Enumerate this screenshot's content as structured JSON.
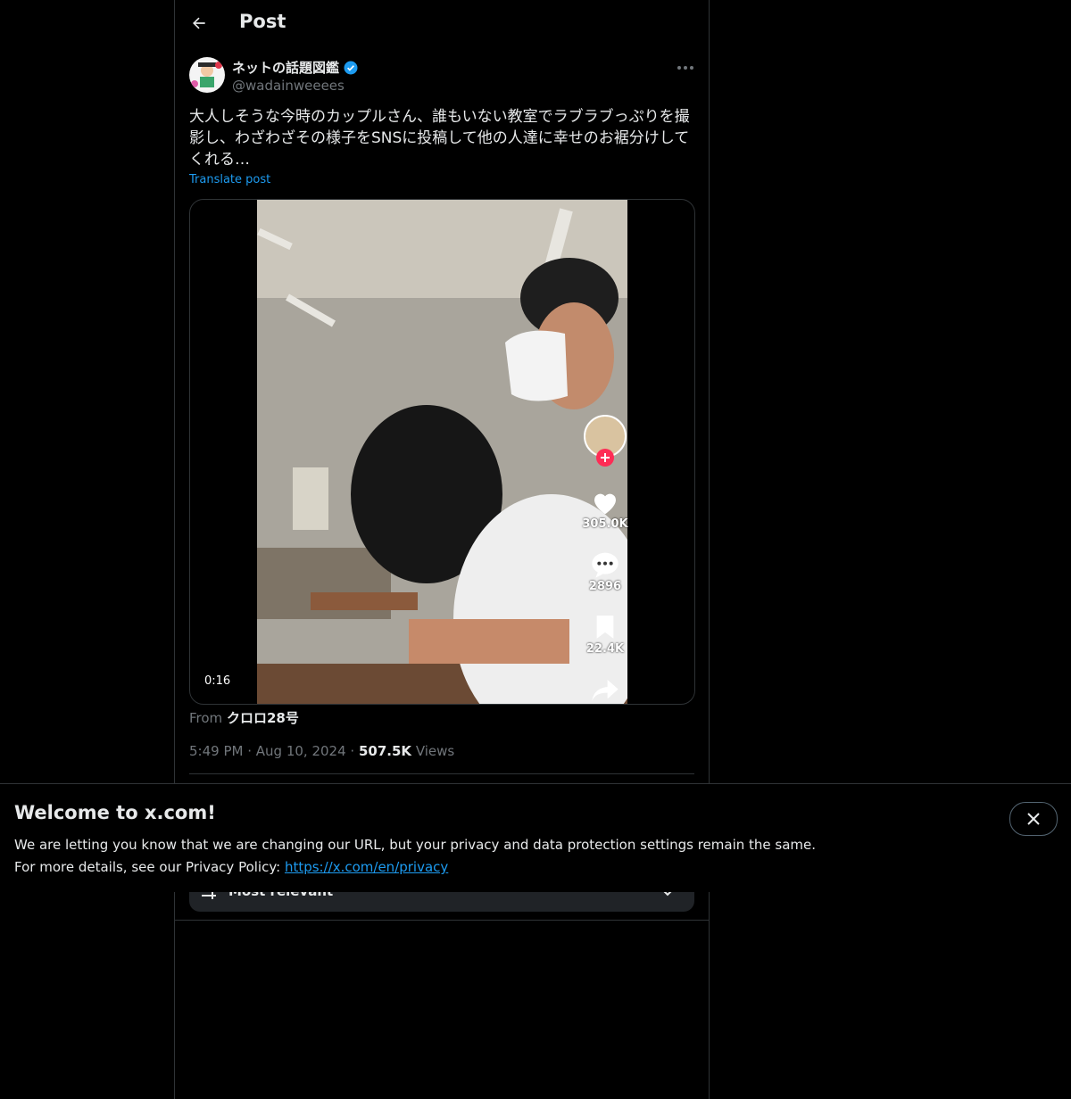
{
  "header": {
    "title": "Post"
  },
  "author": {
    "display_name": "ネットの話題図鑑",
    "handle": "@wadainweeees"
  },
  "post": {
    "text": "大人しそうな今時のカップルさん、誰もいない教室でラブラブっぷりを撮影し、わざわざその様子をSNSに投稿して他の人達に幸せのお裾分けしてくれる…",
    "translate_label": "Translate post",
    "video_duration": "0:16",
    "video_overlay": {
      "likes": "305.0K",
      "comments": "2896",
      "saves": "22.4K"
    },
    "from_label": "From",
    "from_name": "クロロ28号",
    "time": "5:49 PM",
    "date": "Aug 10, 2024",
    "views_count": "507.5K",
    "views_label": "Views"
  },
  "replies": {
    "sort_label": "Most relevant"
  },
  "banner": {
    "title": "Welcome to x.com!",
    "line1": "We are letting you know that we are changing our URL, but your privacy and data protection settings remain the same.",
    "line2_prefix": "For more details, see our Privacy Policy: ",
    "link": "https://x.com/en/privacy"
  },
  "colors": {
    "accent": "#1d9bf0",
    "background": "#000000",
    "border": "#2f3336",
    "muted": "#71767b"
  }
}
